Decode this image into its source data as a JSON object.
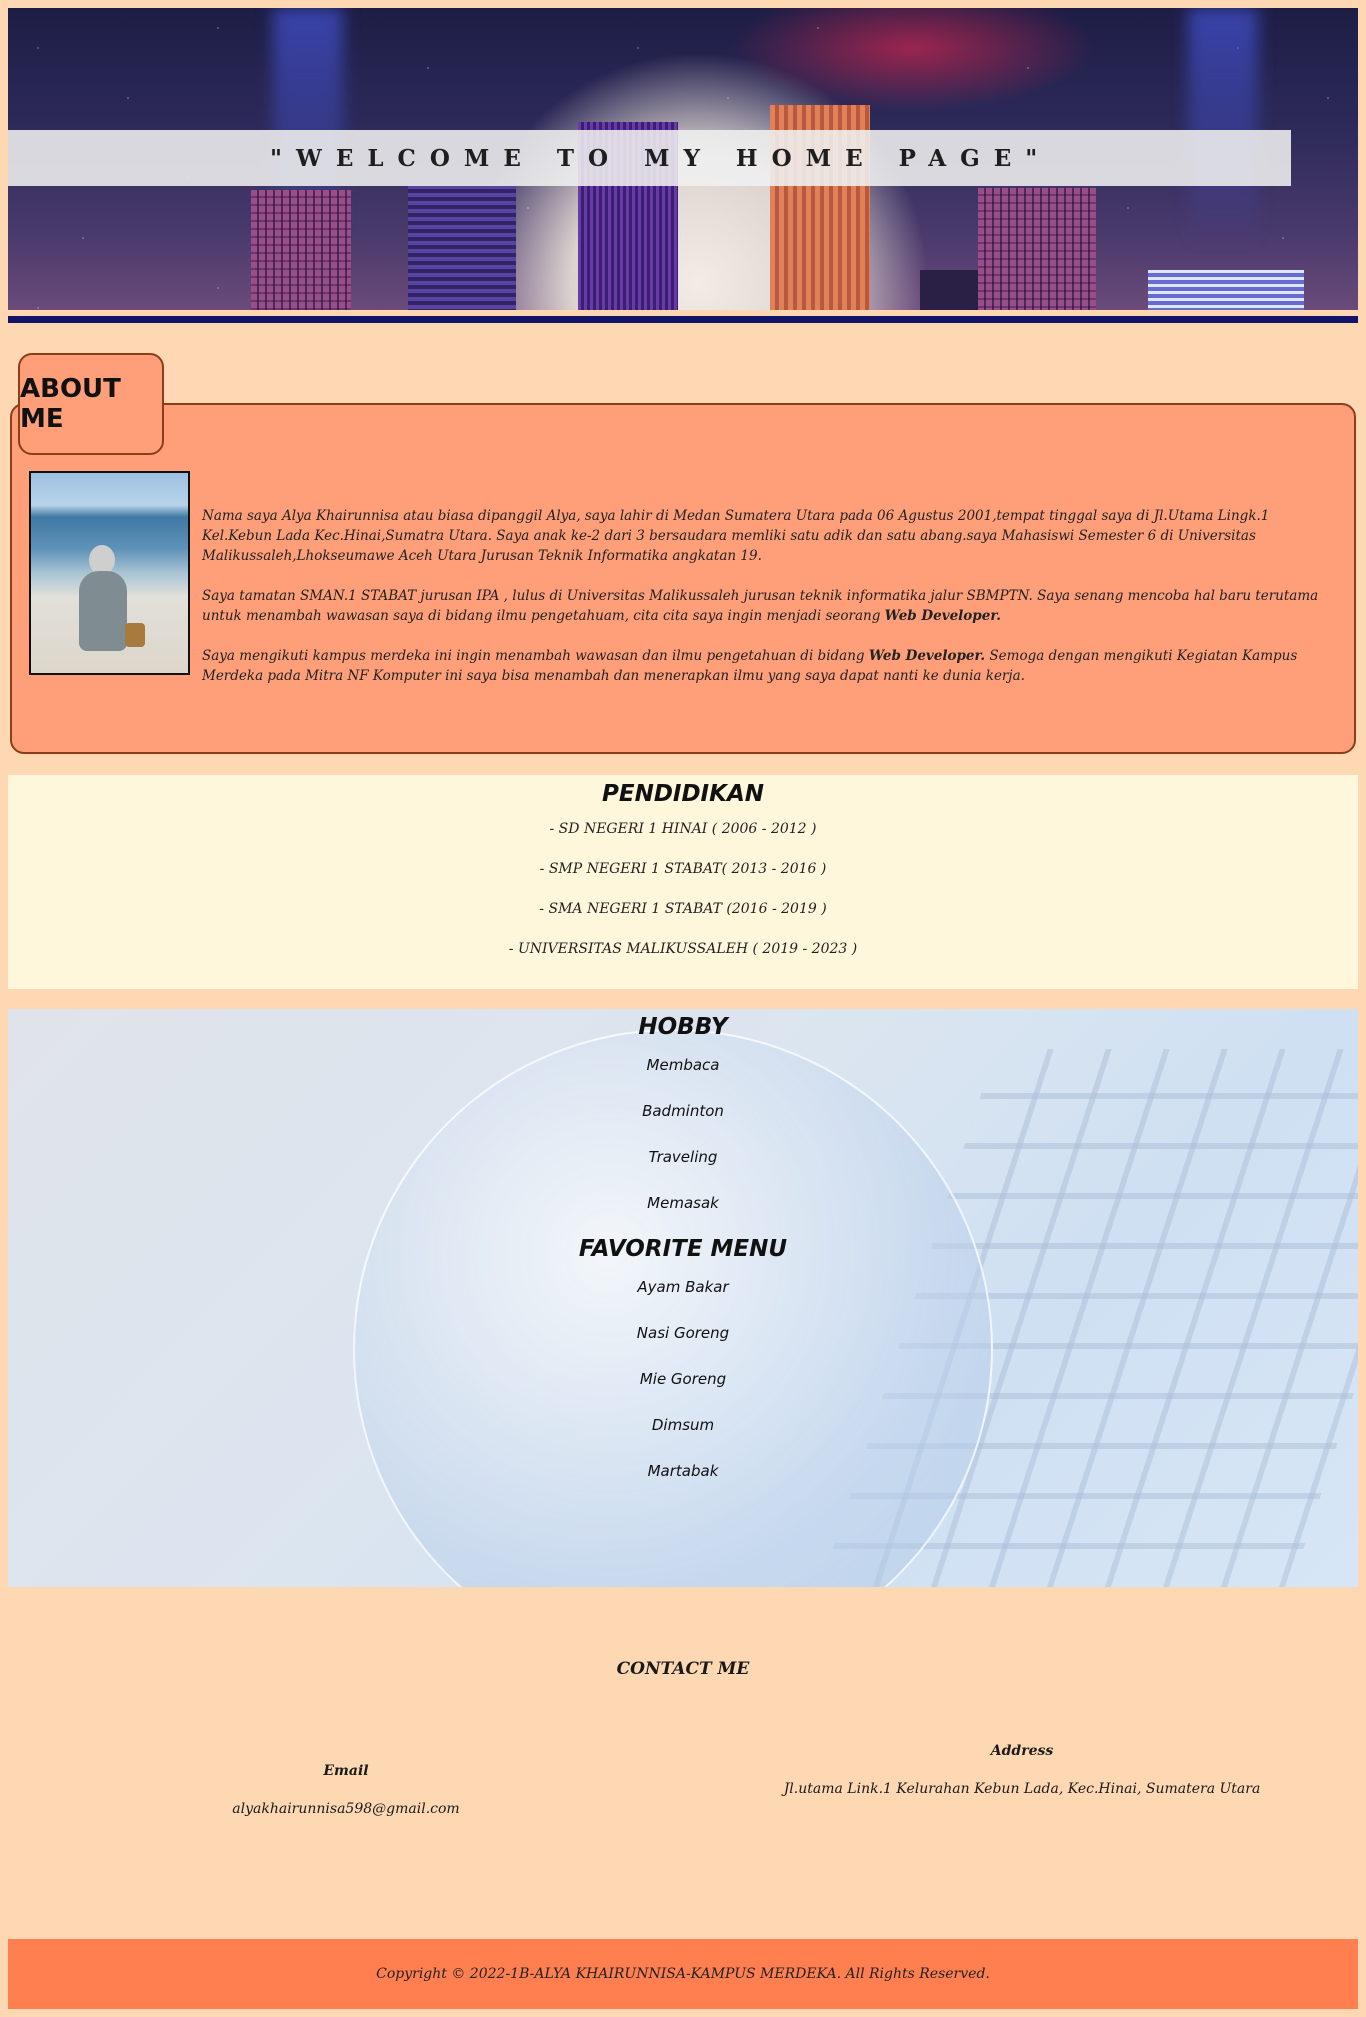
{
  "header": {
    "title": "\"WELCOME TO MY HOME PAGE\""
  },
  "about": {
    "heading": "ABOUT ME",
    "paragraph1": "Nama saya Alya Khairunnisa atau biasa dipanggil Alya, saya lahir di Medan Sumatera Utara pada 06 Agustus 2001,tempat tinggal saya di Jl.Utama Lingk.1 Kel.Kebun Lada Kec.Hinai,Sumatra Utara. Saya anak ke-2 dari 3 bersaudara memliki satu adik dan satu abang.saya Mahasiswi Semester 6 di Universitas Malikussaleh,Lhokseumawe Aceh Utara Jurusan Teknik Informatika angkatan 19.",
    "paragraph2_text": "Saya tamatan SMAN.1 STABAT jurusan IPA , lulus di Universitas Malikussaleh jurusan teknik informatika jalur SBMPTN. Saya senang mencoba hal baru terutama untuk menambah wawasan saya di bidang ilmu pengetahuam, cita cita saya ingin menjadi seorang ",
    "paragraph2_bold": "Web Developer.",
    "paragraph3_text": "Saya mengikuti kampus merdeka ini ingin menambah wawasan dan ilmu pengetahuan di bidang ",
    "paragraph3_bold": "Web Developer.",
    "paragraph3_rest": " Semoga dengan mengikuti Kegiatan Kampus Merdeka pada Mitra NF Komputer ini saya bisa menambah dan menerapkan ilmu yang saya dapat nanti ke dunia kerja."
  },
  "education": {
    "heading": "PENDIDIKAN",
    "items": [
      "- SD NEGERI 1 HINAI ( 2006 - 2012 )",
      "- SMP NEGERI 1 STABAT( 2013 - 2016 )",
      "- SMA NEGERI 1 STABAT (2016 - 2019 )",
      "- UNIVERSITAS MALIKUSSALEH ( 2019 - 2023 )"
    ]
  },
  "hobby": {
    "heading": "HOBBY",
    "items": [
      "Membaca",
      "Badminton",
      "Traveling",
      "Memasak"
    ]
  },
  "favorite_menu": {
    "heading": "FAVORITE MENU",
    "items": [
      "Ayam Bakar",
      "Nasi Goreng",
      "Mie Goreng",
      "Dimsum",
      "Martabak"
    ]
  },
  "contact": {
    "heading": "CONTACT ME",
    "email_label": "Email",
    "email_value": "alyakhairunnisa598@gmail.com",
    "address_label": "Address",
    "address_value": "Jl.utama Link.1 Kelurahan Kebun Lada, Kec.Hinai, Sumatera Utara"
  },
  "footer": {
    "copyright": "Copyright © 2022-1B-ALYA KHAIRUNNISA-KAMPUS MERDEKA. All Rights Reserved."
  },
  "colors": {
    "page_bg": "#fed8b3",
    "about_bg": "#ff9f7a",
    "education_bg": "#fff7dc",
    "footer_bg": "#ff7f50",
    "rule": "#131367"
  }
}
